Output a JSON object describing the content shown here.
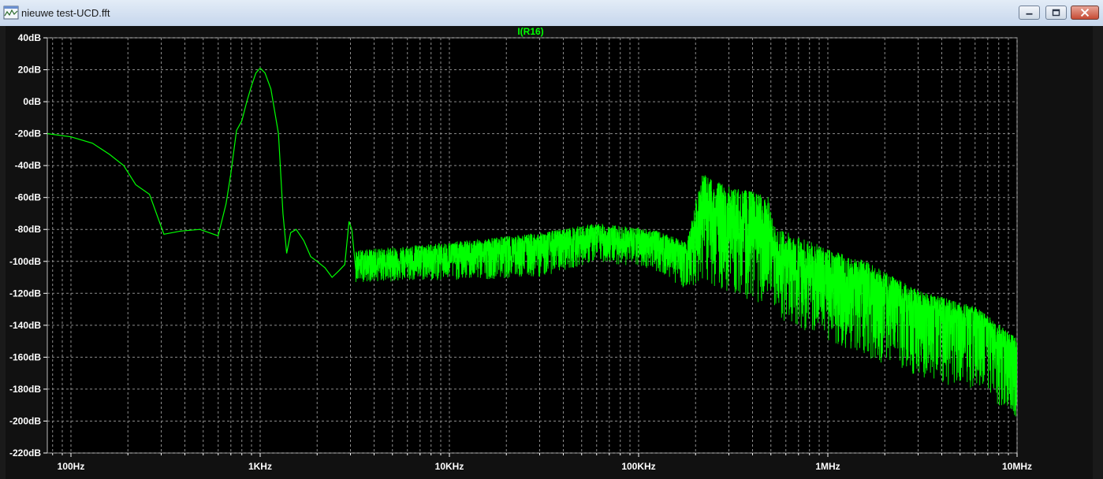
{
  "window": {
    "title": "nieuwe test-UCD.fft",
    "icon": "waveform-viewer-icon"
  },
  "colors": {
    "plot_background": "#000000",
    "frame_background": "#1a1a1a",
    "grid": "#8c8c8c",
    "trace": "#00ff00",
    "axis_text": "#ffffff"
  },
  "chart_data": {
    "type": "line",
    "title": "I(R16)",
    "xscale": "log",
    "x_unit": "Hz",
    "xlim": [
      75,
      10000000
    ],
    "ylim": [
      -220,
      40
    ],
    "grid": true,
    "x_ticks": [
      {
        "value": 100,
        "label": "100Hz"
      },
      {
        "value": 1000,
        "label": "1KHz"
      },
      {
        "value": 10000,
        "label": "10KHz"
      },
      {
        "value": 100000,
        "label": "100KHz"
      },
      {
        "value": 1000000,
        "label": "1MHz"
      },
      {
        "value": 10000000,
        "label": "10MHz"
      }
    ],
    "y_ticks": [
      {
        "value": 40,
        "label": "40dB"
      },
      {
        "value": 20,
        "label": "20dB"
      },
      {
        "value": 0,
        "label": "0dB"
      },
      {
        "value": -20,
        "label": "-20dB"
      },
      {
        "value": -40,
        "label": "-40dB"
      },
      {
        "value": -60,
        "label": "-60dB"
      },
      {
        "value": -80,
        "label": "-80dB"
      },
      {
        "value": -100,
        "label": "-100dB"
      },
      {
        "value": -120,
        "label": "-120dB"
      },
      {
        "value": -140,
        "label": "-140dB"
      },
      {
        "value": -160,
        "label": "-160dB"
      },
      {
        "value": -180,
        "label": "-180dB"
      },
      {
        "value": -200,
        "label": "-200dB"
      },
      {
        "value": -220,
        "label": "-220dB"
      }
    ],
    "series": [
      {
        "name": "I(R16)",
        "color": "#00ff00",
        "lowfreq_curve": [
          [
            75,
            -20
          ],
          [
            100,
            -22
          ],
          [
            130,
            -26
          ],
          [
            160,
            -33
          ],
          [
            190,
            -40
          ],
          [
            220,
            -52
          ],
          [
            260,
            -58
          ],
          [
            310,
            -83
          ],
          [
            380,
            -81
          ],
          [
            480,
            -80
          ],
          [
            600,
            -84
          ],
          [
            660,
            -64
          ],
          [
            700,
            -45
          ],
          [
            750,
            -18
          ],
          [
            800,
            -12
          ],
          [
            850,
            0
          ],
          [
            900,
            10
          ],
          [
            950,
            18
          ],
          [
            1000,
            21
          ],
          [
            1060,
            18
          ],
          [
            1140,
            8
          ],
          [
            1250,
            -20
          ],
          [
            1320,
            -70
          ],
          [
            1380,
            -95
          ],
          [
            1450,
            -82
          ],
          [
            1550,
            -80
          ],
          [
            1700,
            -87
          ],
          [
            1850,
            -97
          ],
          [
            2000,
            -100
          ],
          [
            2200,
            -104
          ],
          [
            2400,
            -110
          ],
          [
            2600,
            -106
          ],
          [
            2800,
            -102
          ],
          [
            2950,
            -75
          ],
          [
            3050,
            -80
          ],
          [
            3200,
            -105
          ]
        ],
        "noise_envelope": [
          {
            "x": 3200,
            "median": -103,
            "upper": -93,
            "lower": -113
          },
          {
            "x": 10000,
            "median": -98,
            "upper": -88,
            "lower": -112
          },
          {
            "x": 30000,
            "median": -92,
            "upper": -82,
            "lower": -110
          },
          {
            "x": 60000,
            "median": -87,
            "upper": -76,
            "lower": -100
          },
          {
            "x": 120000,
            "median": -90,
            "upper": -80,
            "lower": -105
          },
          {
            "x": 180000,
            "median": -95,
            "upper": -88,
            "lower": -118
          },
          {
            "x": 215000,
            "median": -72,
            "upper": -45,
            "lower": -112
          },
          {
            "x": 300000,
            "median": -80,
            "upper": -53,
            "lower": -120
          },
          {
            "x": 480000,
            "median": -88,
            "upper": -58,
            "lower": -128
          },
          {
            "x": 520000,
            "median": -100,
            "upper": -78,
            "lower": -135
          },
          {
            "x": 1000000,
            "median": -112,
            "upper": -92,
            "lower": -150
          },
          {
            "x": 1600000,
            "median": -120,
            "upper": -100,
            "lower": -160
          },
          {
            "x": 3000000,
            "median": -130,
            "upper": -118,
            "lower": -172
          },
          {
            "x": 6000000,
            "median": -140,
            "upper": -128,
            "lower": -185
          },
          {
            "x": 10000000,
            "median": -160,
            "upper": -148,
            "lower": -198
          }
        ]
      }
    ]
  }
}
